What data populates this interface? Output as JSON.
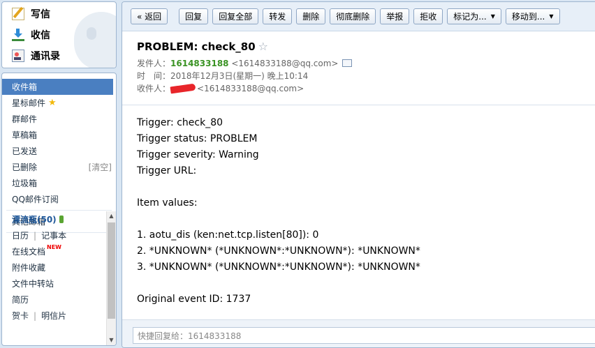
{
  "sidebar": {
    "top": [
      {
        "label": "写信",
        "icon": "compose-icon"
      },
      {
        "label": "收信",
        "icon": "inbox-download-icon"
      },
      {
        "label": "通讯录",
        "icon": "contacts-icon"
      }
    ],
    "folders": [
      {
        "label": "收件箱"
      },
      {
        "label": "星标邮件"
      },
      {
        "label": "群邮件"
      },
      {
        "label": "草稿箱"
      },
      {
        "label": "已发送"
      },
      {
        "label": "已删除",
        "suffix": "[清空]"
      },
      {
        "label": "垃圾箱"
      },
      {
        "label": "QQ邮件订阅"
      }
    ],
    "other_mailbox": "其他邮箱",
    "drift_bottle": "漂流瓶(50)",
    "calendar": "日历",
    "notepad": "记事本",
    "online_docs": "在线文档",
    "new_badge": "NEW",
    "attachments": "附件收藏",
    "file_transfer": "文件中转站",
    "resume": "简历",
    "greeting_card": "贺卡",
    "postcard": "明信片"
  },
  "toolbar": {
    "back": "« 返回",
    "reply": "回复",
    "reply_all": "回复全部",
    "forward": "转发",
    "delete": "删除",
    "delete_forever": "彻底删除",
    "report": "举报",
    "reject": "拒收",
    "mark_as": "标记为...",
    "move_to": "移动到..."
  },
  "message": {
    "subject": "PROBLEM: check_80",
    "from_label": "发件人：",
    "from_name": "1614833188",
    "from_email": "<1614833188@qq.com>",
    "time_label": "时　间：",
    "time_value": "2018年12月3日(星期一) 晚上10:14",
    "to_label": "收件人：",
    "to_email": "<1614833188@qq.com>",
    "body_lines": [
      "Trigger: check_80",
      "Trigger status: PROBLEM",
      "Trigger severity: Warning",
      "Trigger URL:",
      "",
      "Item values:",
      "",
      "1. aotu_dis (ken:net.tcp.listen[80]): 0",
      "2. *UNKNOWN* (*UNKNOWN*:*UNKNOWN*): *UNKNOWN*",
      "3. *UNKNOWN* (*UNKNOWN*:*UNKNOWN*): *UNKNOWN*",
      "",
      "Original event ID: 1737"
    ]
  },
  "quick_reply": {
    "placeholder": "快捷回复给：1614833188"
  }
}
